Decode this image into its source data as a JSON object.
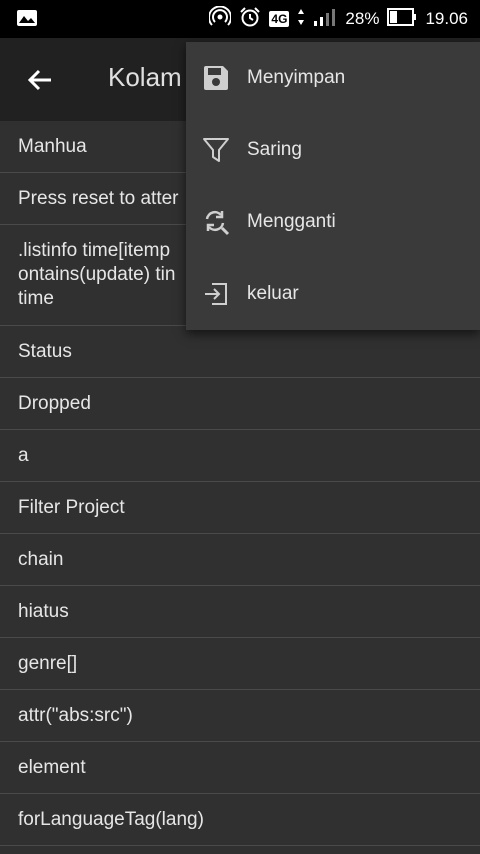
{
  "status_bar": {
    "network_type": "4G",
    "battery_percent": "28%",
    "time": "19.06"
  },
  "app_bar": {
    "title": "Kolam"
  },
  "list": {
    "items": [
      "Manhua",
      "Press reset to atter",
      ".listinfo time[itemp\nontains(update) tin\ntime",
      "Status",
      "Dropped",
      "a",
      "Filter Project",
      "chain",
      "hiatus",
      "genre[]",
      "attr(\"abs:src\")",
      "element",
      "forLanguageTag(lang)"
    ]
  },
  "menu": {
    "items": [
      {
        "label": "Menyimpan",
        "icon": "save-icon"
      },
      {
        "label": "Saring",
        "icon": "filter-icon"
      },
      {
        "label": "Mengganti",
        "icon": "replace-icon"
      },
      {
        "label": "keluar",
        "icon": "exit-icon"
      }
    ]
  },
  "colors": {
    "background": "#303030",
    "app_bar": "#212121",
    "menu": "#3a3a3a",
    "status_bar": "#000000"
  }
}
